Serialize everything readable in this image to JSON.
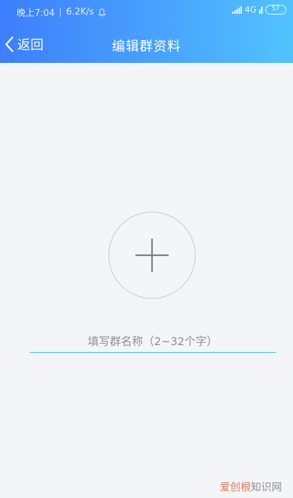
{
  "status_bar": {
    "time": "晚上7:04",
    "speed": "6.2K/s",
    "network": "4G",
    "battery": "57"
  },
  "nav": {
    "back_label": "返回",
    "title": "编辑群资料"
  },
  "form": {
    "name_placeholder": "填写群名称（2~32个字）"
  },
  "watermark": {
    "left": "爱创根",
    "right": "知识网"
  }
}
